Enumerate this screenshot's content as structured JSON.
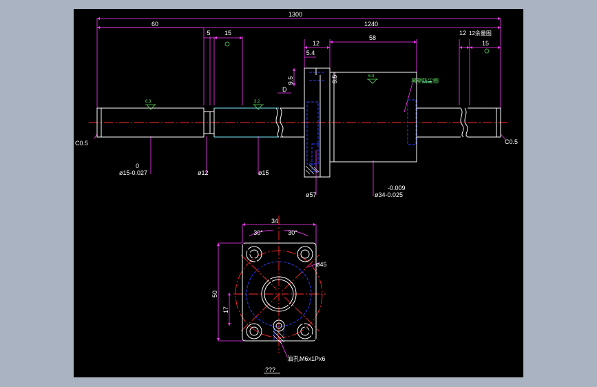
{
  "colors": {
    "background": "#000000",
    "frame": "#aab3c2",
    "outline": "#ffffff",
    "dimension": "#ff3cff",
    "center": "#ff2a2a",
    "hidden": "#2b3cff",
    "text": "#5fe35f",
    "cyan": "#7ff0ff"
  },
  "dims": {
    "overall": "1300",
    "span": "1240",
    "left_len": "60",
    "step_a": "5",
    "step_b": "15",
    "nut_flange": "12",
    "flange_sub": "5.4",
    "nut_body": "58",
    "right_a": "12",
    "right_b": "15",
    "flange_h": "9.5",
    "flange_slot": "8.5",
    "d_mark": "D",
    "chamfer_left": "C0.5",
    "chamfer_right": "C0.5",
    "dia_left_tol_top": "0",
    "dia_left": "ø15-0.027",
    "dia_12": "ø12",
    "dia_15": "ø15",
    "dia_57": "ø57",
    "dia_34_tol_top": "-0.009",
    "dia_34": "ø34-0.025",
    "roughness_a": "6.3",
    "roughness_b": "3.2",
    "roughness_c": "6.3",
    "note_right": "12余量图",
    "note_seal": "黑塑防尘圈"
  },
  "view": {
    "width": "34",
    "angle_left": "30°",
    "angle_right": "30°",
    "pcd": "ø45",
    "height": "50",
    "half": "17",
    "hole_note": "油孔M6x1Px6",
    "caption": "???"
  }
}
